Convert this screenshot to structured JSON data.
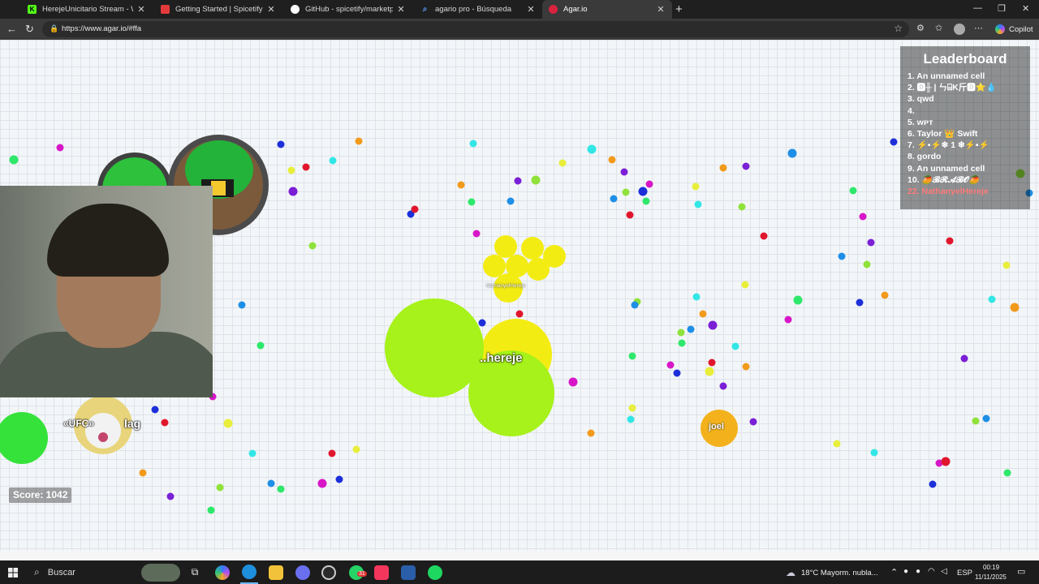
{
  "browser": {
    "tabs": [
      {
        "title": "HerejeUnicitario Stream - Watch Li",
        "favicon_color": "#53fc18",
        "favicon_letter": "K",
        "active": false
      },
      {
        "title": "Getting Started | Spicetify",
        "favicon_color": "#e33b3b",
        "favicon_letter": "",
        "active": false
      },
      {
        "title": "GitHub - spicetify/marketplace: D",
        "favicon_color": "#ffffff",
        "favicon_letter": "",
        "active": false
      },
      {
        "title": "agario pro - Búsqueda",
        "favicon_color": "#3b82f6",
        "favicon_letter": "",
        "active": false
      },
      {
        "title": "Agar.io",
        "favicon_color": "#d8233f",
        "favicon_letter": "",
        "active": true
      }
    ],
    "url": "https://www.agar.io/#ffa",
    "copilot_label": "Copilot"
  },
  "game": {
    "player_name": "NathanyelHereje",
    "player_name_visible": "..hereje",
    "score_label": "Score: 1042",
    "joel_label": "joel",
    "lag_label": "lag",
    "ufc_label": "«UFC»",
    "leaderboard": {
      "title": "Leaderboard",
      "entries": [
        "1. An unnamed cell",
        "2. 🅳╫ | ㄣ⌸K斤🅳⭐💧",
        "3. qwd",
        "4.",
        "5. ᴡᴘᴛ",
        "6. Taylor 👑 Swift",
        "7. ⚡▪⚡❄ 1 ❄⚡▪⚡",
        "8. gordo",
        "9. An unnamed cell",
        "10. 🥭𝓑𝓡𝓐𝓑𝓞🥭",
        "22. NathanyelHereje"
      ]
    }
  },
  "taskbar": {
    "search_placeholder": "Buscar",
    "weather": "18°C  Mayorm. nubla...",
    "language": "ESP",
    "time": "00:19",
    "date": "11/11/2025",
    "whatsapp_badge": "31"
  }
}
